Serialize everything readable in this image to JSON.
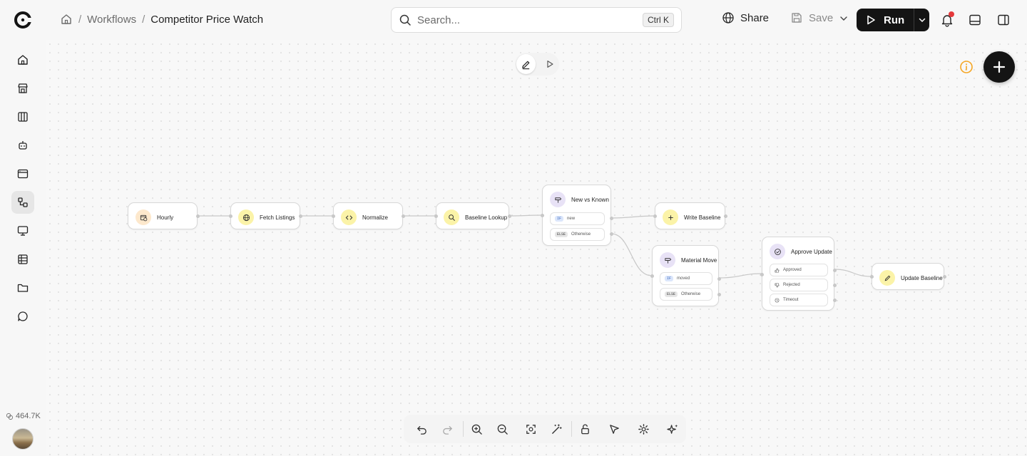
{
  "header": {
    "breadcrumbs": [
      "Workflows",
      "Competitor Price Watch"
    ],
    "search_placeholder": "Search...",
    "search_shortcut": "Ctrl K",
    "share_label": "Share",
    "save_label": "Save",
    "run_label": "Run"
  },
  "sidebar": {
    "items": [
      "home",
      "store",
      "columns",
      "bot",
      "browser",
      "workflows",
      "monitor",
      "table",
      "folder",
      "chat"
    ],
    "active": "workflows",
    "token_count": "464.7K"
  },
  "nodes": {
    "hourly": "Hourly",
    "fetch": "Fetch Listings",
    "normalize": "Normalize",
    "baseline_lookup": "Baseline Lookup",
    "new_vs_known": {
      "title": "New vs Known",
      "if_tag": "IF",
      "if_label": "new",
      "else_tag": "ELSE",
      "else_label": "Otherwise"
    },
    "write_baseline": "Write Baseline",
    "material_move": {
      "title": "Material Move",
      "if_tag": "IF",
      "if_label": "moved",
      "else_tag": "ELSE",
      "else_label": "Otherwise"
    },
    "approve_update": {
      "title": "Approve Update",
      "approved": "Approved",
      "rejected": "Rejected",
      "timeout": "Timeout"
    },
    "update_baseline": "Update Baseline"
  },
  "colors": {
    "run_bg": "#141414",
    "notif": "#e5393b",
    "info": "#f5a623",
    "if_tag": "#dbe6fb"
  }
}
